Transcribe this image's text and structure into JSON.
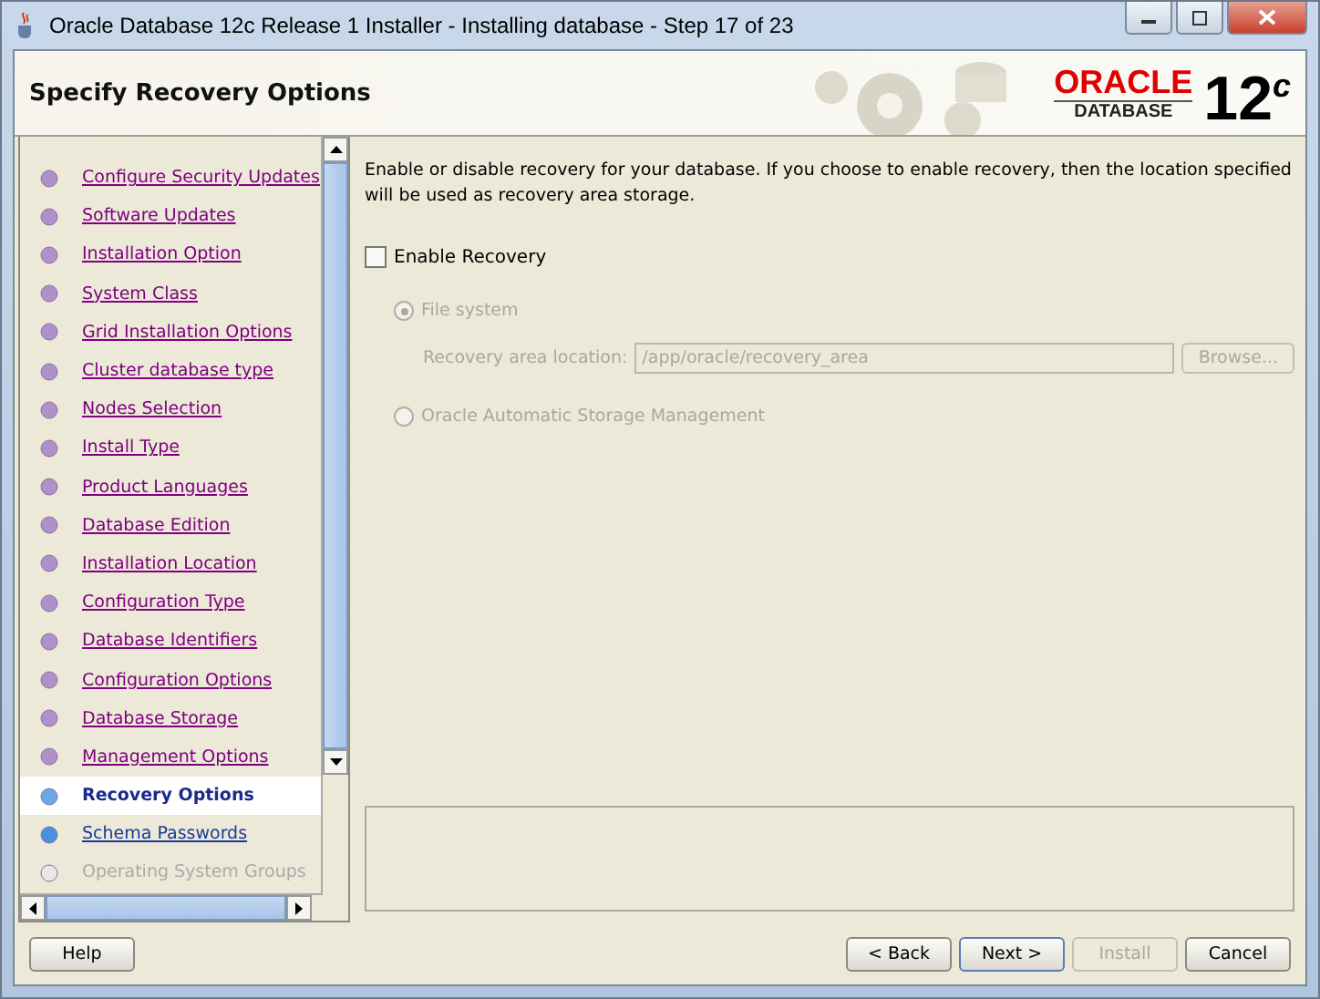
{
  "window": {
    "title": "Oracle Database 12c Release 1 Installer - Installing database - Step 17 of 23"
  },
  "header": {
    "title": "Specify Recovery Options",
    "logo_brand": "ORACLE",
    "logo_product": "DATABASE",
    "logo_version": "12$^{c}$"
  },
  "steps": [
    {
      "label": "Configure Security Updates",
      "visited": true,
      "selected": false,
      "disabled": false
    },
    {
      "label": "Software Updates",
      "visited": true,
      "selected": false,
      "disabled": false
    },
    {
      "label": "Installation Option",
      "visited": true,
      "selected": false,
      "disabled": false
    },
    {
      "label": "System Class",
      "visited": true,
      "selected": false,
      "disabled": false
    },
    {
      "label": "Grid Installation Options",
      "visited": true,
      "selected": false,
      "disabled": false
    },
    {
      "label": "Cluster database type",
      "visited": true,
      "selected": false,
      "disabled": false
    },
    {
      "label": "Nodes Selection",
      "visited": true,
      "selected": false,
      "disabled": false
    },
    {
      "label": "Install Type",
      "visited": true,
      "selected": false,
      "disabled": false
    },
    {
      "label": "Product Languages",
      "visited": true,
      "selected": false,
      "disabled": false
    },
    {
      "label": "Database Edition",
      "visited": true,
      "selected": false,
      "disabled": false
    },
    {
      "label": "Installation Location",
      "visited": true,
      "selected": false,
      "disabled": false
    },
    {
      "label": "Configuration Type",
      "visited": true,
      "selected": false,
      "disabled": false
    },
    {
      "label": "Database Identifiers",
      "visited": true,
      "selected": false,
      "disabled": false
    },
    {
      "label": "Configuration Options",
      "visited": true,
      "selected": false,
      "disabled": false
    },
    {
      "label": "Database Storage",
      "visited": true,
      "selected": false,
      "disabled": false
    },
    {
      "label": "Management Options",
      "visited": true,
      "selected": false,
      "disabled": false
    },
    {
      "label": "Recovery Options",
      "visited": false,
      "selected": true,
      "disabled": false
    },
    {
      "label": "Schema Passwords",
      "visited": false,
      "selected": false,
      "disabled": false
    },
    {
      "label": "Operating System Groups",
      "visited": false,
      "selected": false,
      "disabled": true
    }
  ],
  "content": {
    "description": "Enable or disable recovery for your database. If you choose to enable recovery, then the location specified will be used as recovery area storage.",
    "enable": {
      "label": "Enable Recovery",
      "checked": false
    },
    "options": [
      {
        "label": "File system",
        "selected": true,
        "disabled": true
      },
      {
        "label": "Oracle Automatic Storage Management",
        "selected": false,
        "disabled": true
      }
    ],
    "location": {
      "label": "Recovery area location:",
      "value": "/app/oracle/recovery_area",
      "disabled": true
    },
    "browse": {
      "label": "Browse...",
      "disabled": true
    }
  },
  "buttons": [
    {
      "label": "Help",
      "disabled": false,
      "default": false
    },
    {
      "label": "< Back",
      "disabled": false,
      "default": false
    },
    {
      "label": "Next >",
      "disabled": false,
      "default": true
    },
    {
      "label": "Install",
      "disabled": true,
      "default": false
    },
    {
      "label": "Cancel",
      "disabled": false,
      "default": false
    }
  ]
}
